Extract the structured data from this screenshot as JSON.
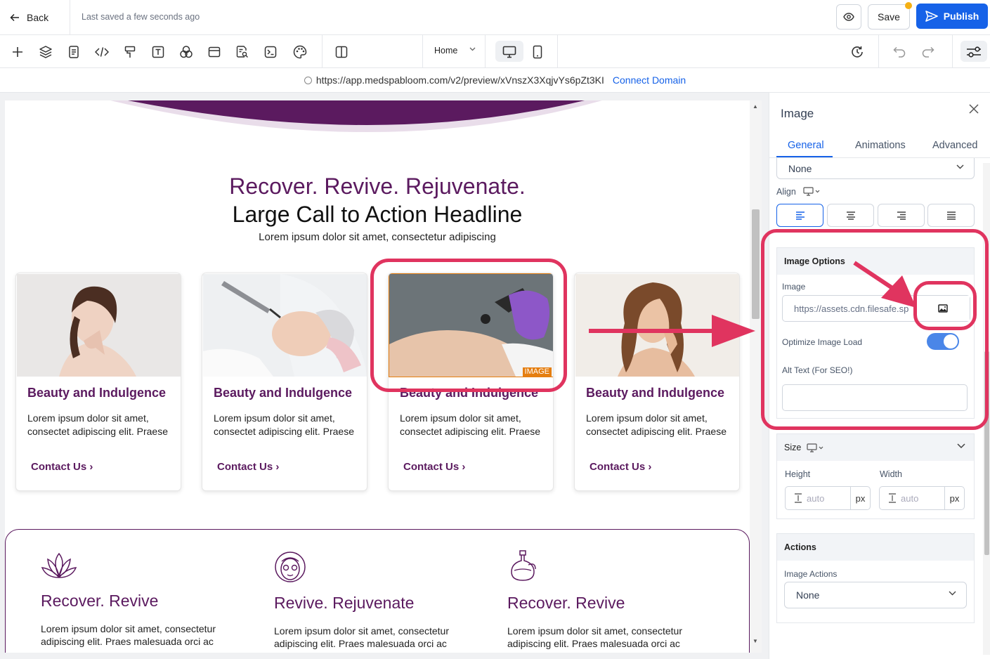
{
  "topbar": {
    "back_label": "Back",
    "saved_status": "Last saved a few seconds ago",
    "save_label": "Save",
    "publish_label": "Publish"
  },
  "toolbar": {
    "page_select": "Home"
  },
  "urlbar": {
    "url": "https://app.medspabloom.com/v2/preview/xVnszX3XqjvYs6pZt3KI",
    "connect_label": "Connect Domain"
  },
  "hero": {
    "headline_1": "Recover. Revive. Rejuvenate.",
    "headline_2": "Large Call to Action Headline",
    "subtext": "Lorem ipsum dolor sit amet, consectetur adipiscing"
  },
  "cards": [
    {
      "title": "Beauty and Indulgence",
      "body": "Lorem ipsum dolor sit amet, consectet adipiscing elit. Praese",
      "link": "Contact Us"
    },
    {
      "title": "Beauty and Indulgence",
      "body": "Lorem ipsum dolor sit amet, consectet adipiscing elit. Praese",
      "link": "Contact Us"
    },
    {
      "title": "Beauty and Indulgence",
      "body": "Lorem ipsum dolor sit amet, consectet adipiscing elit. Praese",
      "link": "Contact Us",
      "image_tag": "IMAGE"
    },
    {
      "title": "Beauty and Indulgence",
      "body": "Lorem ipsum dolor sit amet, consectet adipiscing elit. Praese",
      "link": "Contact Us"
    }
  ],
  "features": [
    {
      "icon": "lotus-icon",
      "title": "Recover. Revive",
      "body": "Lorem ipsum dolor sit amet, consectetur adipiscing elit. Praes malesuada orci ac"
    },
    {
      "icon": "face-mask-icon",
      "title": "Revive. Rejuvenate",
      "body": "Lorem ipsum dolor sit amet, consectetur adipiscing elit. Praes malesuada orci ac"
    },
    {
      "icon": "oil-bottle-icon",
      "title": "Recover. Revive",
      "body": "Lorem ipsum dolor sit amet, consectetur adipiscing elit. Praes malesuada orci ac"
    }
  ],
  "panel": {
    "title": "Image",
    "tabs": [
      "General",
      "Animations",
      "Advanced"
    ],
    "active_tab": "General",
    "top_select_value": "None",
    "align_label": "Align",
    "image_options": {
      "heading": "Image Options",
      "image_label": "Image",
      "image_url": "https://assets.cdn.filesafe.sp",
      "optimize_label": "Optimize Image Load",
      "optimize_enabled": true,
      "alt_label": "Alt Text (For SEO!)",
      "alt_value": ""
    },
    "size": {
      "heading": "Size",
      "height_label": "Height",
      "width_label": "Width",
      "height_placeholder": "auto",
      "width_placeholder": "auto",
      "unit": "px"
    },
    "actions": {
      "heading": "Actions",
      "image_actions_label": "Image Actions",
      "image_actions_value": "None"
    }
  },
  "colors": {
    "brand_purple": "#5b1a5f",
    "accent_blue": "#1662e8",
    "annotation_pink": "#e0345f",
    "save_dot": "#f5b014"
  }
}
